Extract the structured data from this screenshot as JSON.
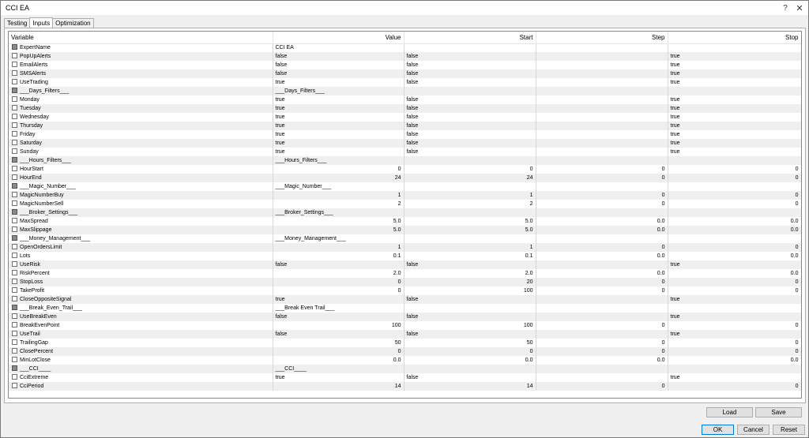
{
  "window": {
    "title": "CCI EA",
    "help_glyph": "?",
    "close_glyph": "✕"
  },
  "tabs": [
    {
      "label": "Testing",
      "active": false
    },
    {
      "label": "Inputs",
      "active": true
    },
    {
      "label": "Optimization",
      "active": false
    }
  ],
  "columns": {
    "variable": "Variable",
    "value": "Value",
    "start": "Start",
    "step": "Step",
    "stop": "Stop"
  },
  "rows": [
    {
      "name": "ExpertName",
      "header": true,
      "value": "CCI EA",
      "start": "",
      "step": "",
      "stop": "",
      "numeric": false
    },
    {
      "name": "PopUpAlerts",
      "header": false,
      "value": "false",
      "start": "false",
      "step": "",
      "stop": "true",
      "numeric": false
    },
    {
      "name": "EmailAlerts",
      "header": false,
      "value": "false",
      "start": "false",
      "step": "",
      "stop": "true",
      "numeric": false
    },
    {
      "name": "SMSAlerts",
      "header": false,
      "value": "false",
      "start": "false",
      "step": "",
      "stop": "true",
      "numeric": false
    },
    {
      "name": "UseTrading",
      "header": false,
      "value": "true",
      "start": "false",
      "step": "",
      "stop": "true",
      "numeric": false
    },
    {
      "name": "___Days_Filters___",
      "header": true,
      "value": "___Days_Filters___",
      "start": "",
      "step": "",
      "stop": "",
      "numeric": false
    },
    {
      "name": "Monday",
      "header": false,
      "value": "true",
      "start": "false",
      "step": "",
      "stop": "true",
      "numeric": false
    },
    {
      "name": "Tuesday",
      "header": false,
      "value": "true",
      "start": "false",
      "step": "",
      "stop": "true",
      "numeric": false
    },
    {
      "name": "Wednesday",
      "header": false,
      "value": "true",
      "start": "false",
      "step": "",
      "stop": "true",
      "numeric": false
    },
    {
      "name": "Thursday",
      "header": false,
      "value": "true",
      "start": "false",
      "step": "",
      "stop": "true",
      "numeric": false
    },
    {
      "name": "Friday",
      "header": false,
      "value": "true",
      "start": "false",
      "step": "",
      "stop": "true",
      "numeric": false
    },
    {
      "name": "Saturday",
      "header": false,
      "value": "true",
      "start": "false",
      "step": "",
      "stop": "true",
      "numeric": false
    },
    {
      "name": "Sunday",
      "header": false,
      "value": "true",
      "start": "false",
      "step": "",
      "stop": "true",
      "numeric": false
    },
    {
      "name": "___Hours_Filters___",
      "header": true,
      "value": "___Hours_Filters___",
      "start": "",
      "step": "",
      "stop": "",
      "numeric": false
    },
    {
      "name": "HourStart",
      "header": false,
      "value": "0",
      "start": "0",
      "step": "0",
      "stop": "0",
      "numeric": true
    },
    {
      "name": "HourEnd",
      "header": false,
      "value": "24",
      "start": "24",
      "step": "0",
      "stop": "0",
      "numeric": true
    },
    {
      "name": "___Magic_Number___",
      "header": true,
      "value": "___Magic_Number___",
      "start": "",
      "step": "",
      "stop": "",
      "numeric": false
    },
    {
      "name": "MagicNumberBuy",
      "header": false,
      "value": "1",
      "start": "1",
      "step": "0",
      "stop": "0",
      "numeric": true
    },
    {
      "name": "MagicNumberSell",
      "header": false,
      "value": "2",
      "start": "2",
      "step": "0",
      "stop": "0",
      "numeric": true
    },
    {
      "name": "___Broker_Settings___",
      "header": true,
      "value": "___Broker_Settings___",
      "start": "",
      "step": "",
      "stop": "",
      "numeric": false
    },
    {
      "name": "MaxSpread",
      "header": false,
      "value": "5.0",
      "start": "5.0",
      "step": "0.0",
      "stop": "0.0",
      "numeric": true
    },
    {
      "name": "MaxSlippage",
      "header": false,
      "value": "5.0",
      "start": "5.0",
      "step": "0.0",
      "stop": "0.0",
      "numeric": true
    },
    {
      "name": "___Money_Management___",
      "header": true,
      "value": "___Money_Management___",
      "start": "",
      "step": "",
      "stop": "",
      "numeric": false
    },
    {
      "name": "OpenOrdersLimit",
      "header": false,
      "value": "1",
      "start": "1",
      "step": "0",
      "stop": "0",
      "numeric": true
    },
    {
      "name": "Lots",
      "header": false,
      "value": "0.1",
      "start": "0.1",
      "step": "0.0",
      "stop": "0.0",
      "numeric": true
    },
    {
      "name": "UseRisk",
      "header": false,
      "value": "false",
      "start": "false",
      "step": "",
      "stop": "true",
      "numeric": false
    },
    {
      "name": "RiskPercent",
      "header": false,
      "value": "2.0",
      "start": "2.0",
      "step": "0.0",
      "stop": "0.0",
      "numeric": true
    },
    {
      "name": "StopLoss",
      "header": false,
      "value": "0",
      "start": "20",
      "step": "0",
      "stop": "0",
      "numeric": true
    },
    {
      "name": "TakeProfit",
      "header": false,
      "value": "0",
      "start": "100",
      "step": "0",
      "stop": "0",
      "numeric": true
    },
    {
      "name": "CloseOppositeSignal",
      "header": false,
      "value": "true",
      "start": "false",
      "step": "",
      "stop": "true",
      "numeric": false
    },
    {
      "name": "___Break_Even_Trail___",
      "header": true,
      "value": "___Break Even Trail___",
      "start": "",
      "step": "",
      "stop": "",
      "numeric": false
    },
    {
      "name": "UseBreakEven",
      "header": false,
      "value": "false",
      "start": "false",
      "step": "",
      "stop": "true",
      "numeric": false
    },
    {
      "name": "BreakEvenPoint",
      "header": false,
      "value": "100",
      "start": "100",
      "step": "0",
      "stop": "0",
      "numeric": true
    },
    {
      "name": "UseTrail",
      "header": false,
      "value": "false",
      "start": "false",
      "step": "",
      "stop": "true",
      "numeric": false
    },
    {
      "name": "TrailingGap",
      "header": false,
      "value": "50",
      "start": "50",
      "step": "0",
      "stop": "0",
      "numeric": true
    },
    {
      "name": "ClosePercent",
      "header": false,
      "value": "0",
      "start": "0",
      "step": "0",
      "stop": "0",
      "numeric": true
    },
    {
      "name": "MinLotClose",
      "header": false,
      "value": "0.0",
      "start": "0.0",
      "step": "0.0",
      "stop": "0.0",
      "numeric": true
    },
    {
      "name": "___CCI____",
      "header": true,
      "value": "___CCI____",
      "start": "",
      "step": "",
      "stop": "",
      "numeric": false
    },
    {
      "name": "CciExtreme",
      "header": false,
      "value": "true",
      "start": "false",
      "step": "",
      "stop": "true",
      "numeric": false
    },
    {
      "name": "CciPeriod",
      "header": false,
      "value": "14",
      "start": "14",
      "step": "0",
      "stop": "0",
      "numeric": true
    }
  ],
  "buttons": {
    "load": "Load",
    "save": "Save",
    "ok": "OK",
    "cancel": "Cancel",
    "reset": "Reset"
  }
}
